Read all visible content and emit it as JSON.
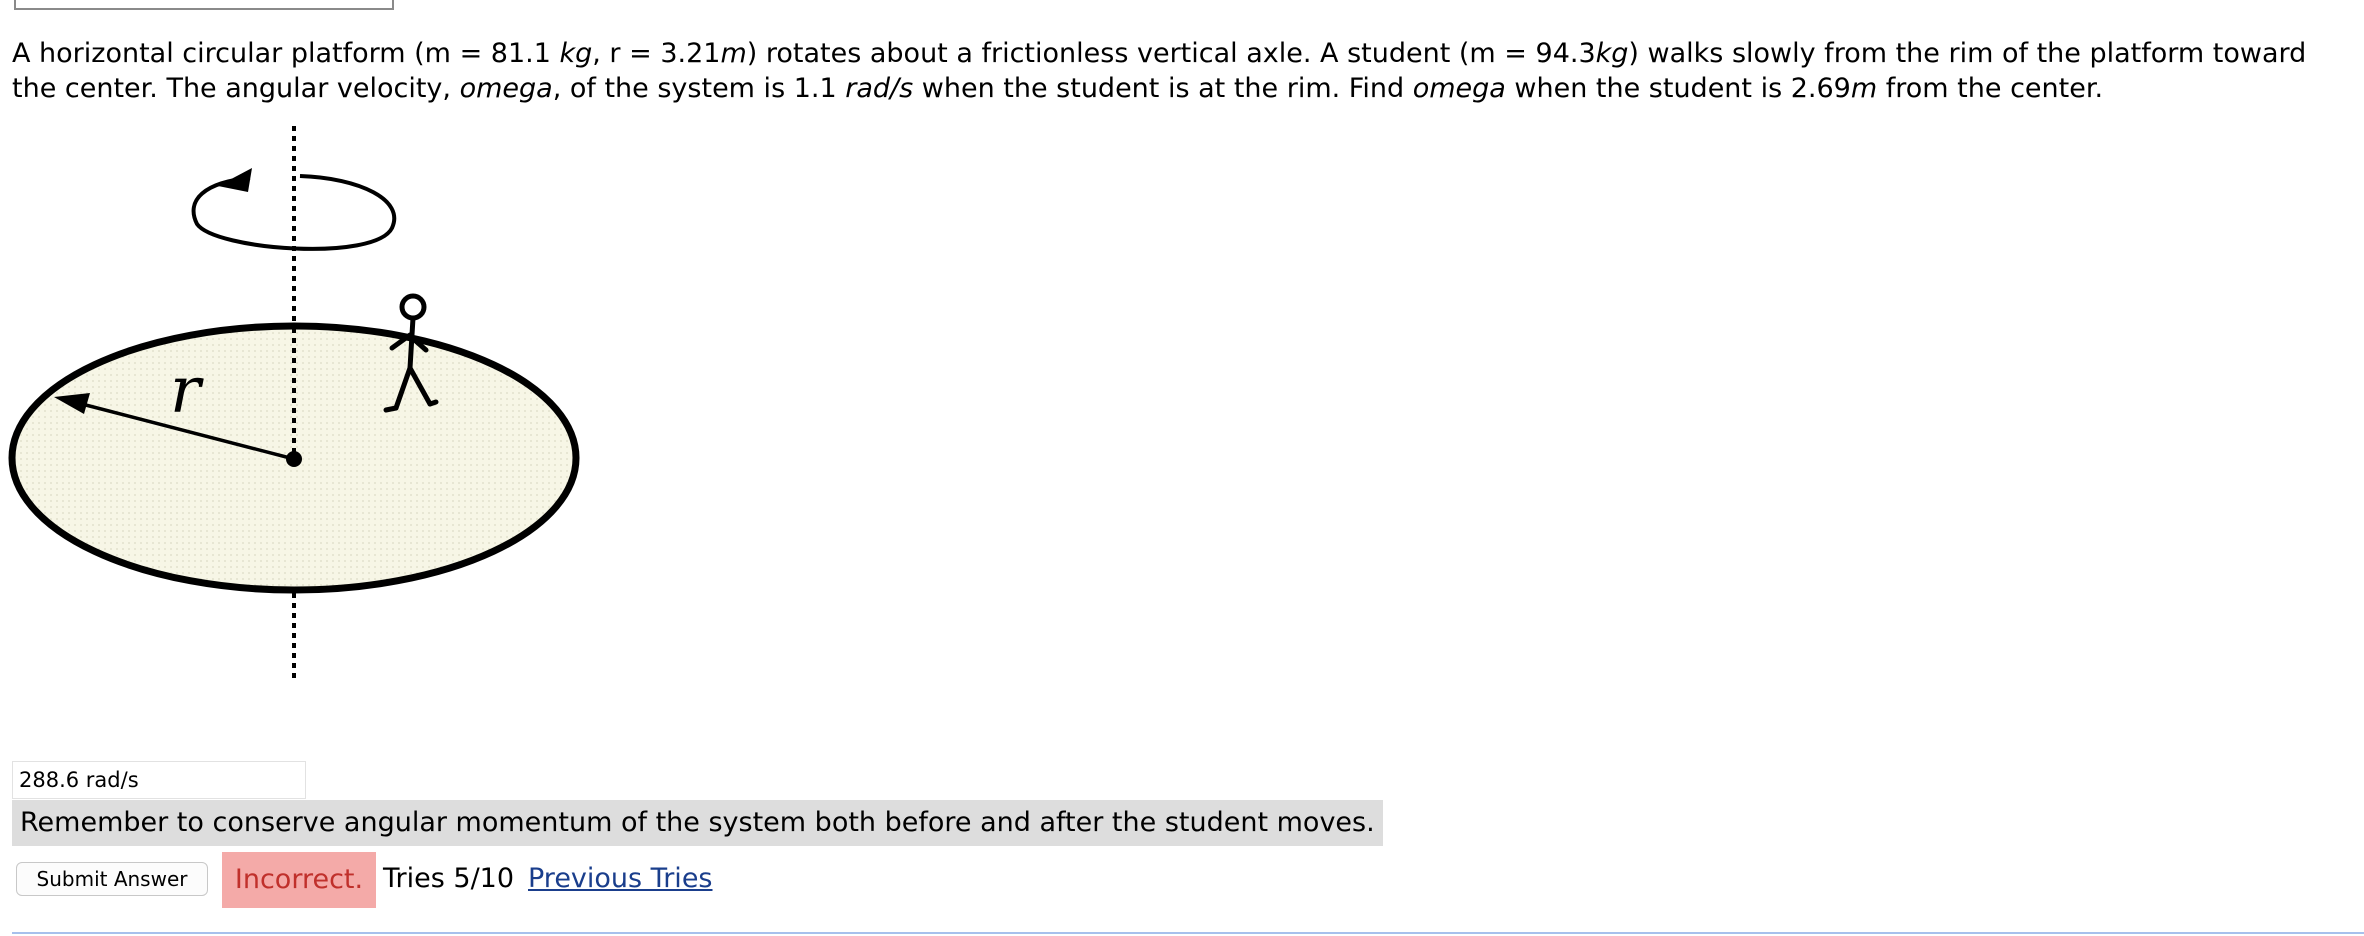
{
  "problem": {
    "s1": "A horizontal circular platform (m = 81.1 ",
    "u1": "kg",
    "s2": ", r = 3.21",
    "u2": "m",
    "s3": ") rotates about a frictionless vertical axle. A student (m = 94.3",
    "u3": "kg",
    "s4": ") walks slowly from the rim of the platform toward the center. The angular velocity, ",
    "u4": "omega",
    "s5": ", of the system is 1.1 ",
    "u5": "rad/s",
    "s6": " when the student is at the rim. Find ",
    "u6": "omega",
    "s7": " when the student is 2.69",
    "u7": "m",
    "s8": " from the center."
  },
  "diagram": {
    "radius_label": "r",
    "icons": [
      "rotation-arrow-icon",
      "student-figure-icon"
    ]
  },
  "answer": {
    "value": "288.6 rad/s"
  },
  "hint": "Remember to conserve angular momentum of the system both before and after the student moves.",
  "feedback": {
    "submit_label": "Submit Answer",
    "status": "Incorrect.",
    "tries": "Tries 5/10",
    "previous_tries_label": "Previous Tries"
  },
  "colors": {
    "incorrect_bg": "#f4aaa8",
    "incorrect_text": "#c0302b",
    "hint_bg": "#dddddd",
    "link": "#1a3e8c",
    "platform_fill": "#f7f6e6"
  }
}
